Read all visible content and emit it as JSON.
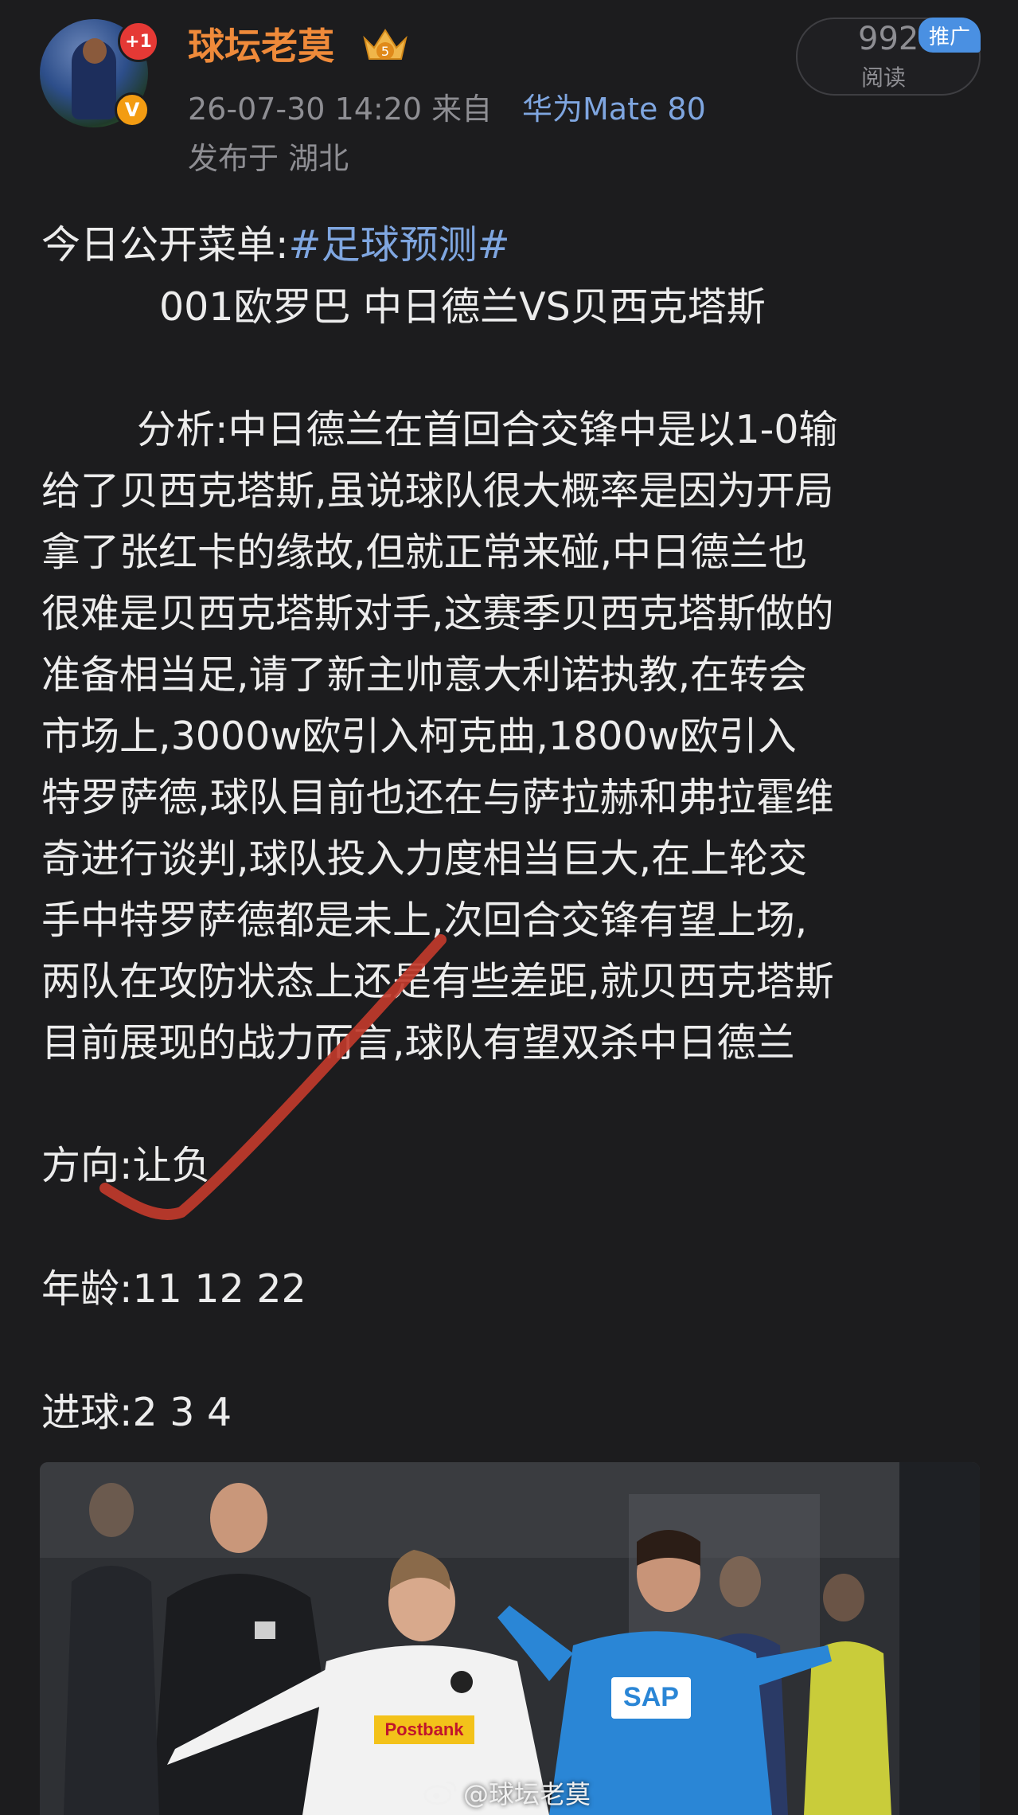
{
  "header": {
    "username": "球坛老莫",
    "badge_plus": "+1",
    "badge_verified": "V",
    "level": "5",
    "post_time": "26-07-30 14:20 来自",
    "device": "华为Mate 80",
    "location": "发布于 湖北",
    "read_count": "992",
    "read_label": "阅读",
    "promo_tag": "推广"
  },
  "post": {
    "topic_prefix": "今日公开菜单:",
    "hashtag": "#足球预测#",
    "match_line": "001欧罗巴  中日德兰VS贝西克塔斯",
    "analysis_lines": [
      "分析:中日德兰在首回合交锋中是以1-0输",
      "给了贝西克塔斯,虽说球队很大概率是因为开局",
      "拿了张红卡的缘故,但就正常来碰,中日德兰也",
      "很难是贝西克塔斯对手,这赛季贝西克塔斯做的",
      "准备相当足,请了新主帅意大利诺执教,在转会",
      "市场上,3000w欧引入柯克曲,1800w欧引入",
      "特罗萨德,球队目前也还在与萨拉赫和弗拉霍维",
      "奇进行谈判,球队投入力度相当巨大,在上轮交",
      "手中特罗萨德都是未上,次回合交锋有望上场,",
      "两队在攻防状态上还是有些差距,就贝西克塔斯",
      "目前展现的战力而言,球队有望双杀中日德兰"
    ],
    "direction": "方向:让负",
    "age": "年龄:11    12    22",
    "goals": "进球:2      3     4"
  },
  "photo": {
    "watermark": "@球坛老莫",
    "sponsor_text": "Postbank",
    "jersey_text": "SAP"
  },
  "colors": {
    "background": "#1c1c1e",
    "username": "#ef8a3a",
    "link": "#7fa6e0",
    "tick": "#c0392b"
  }
}
